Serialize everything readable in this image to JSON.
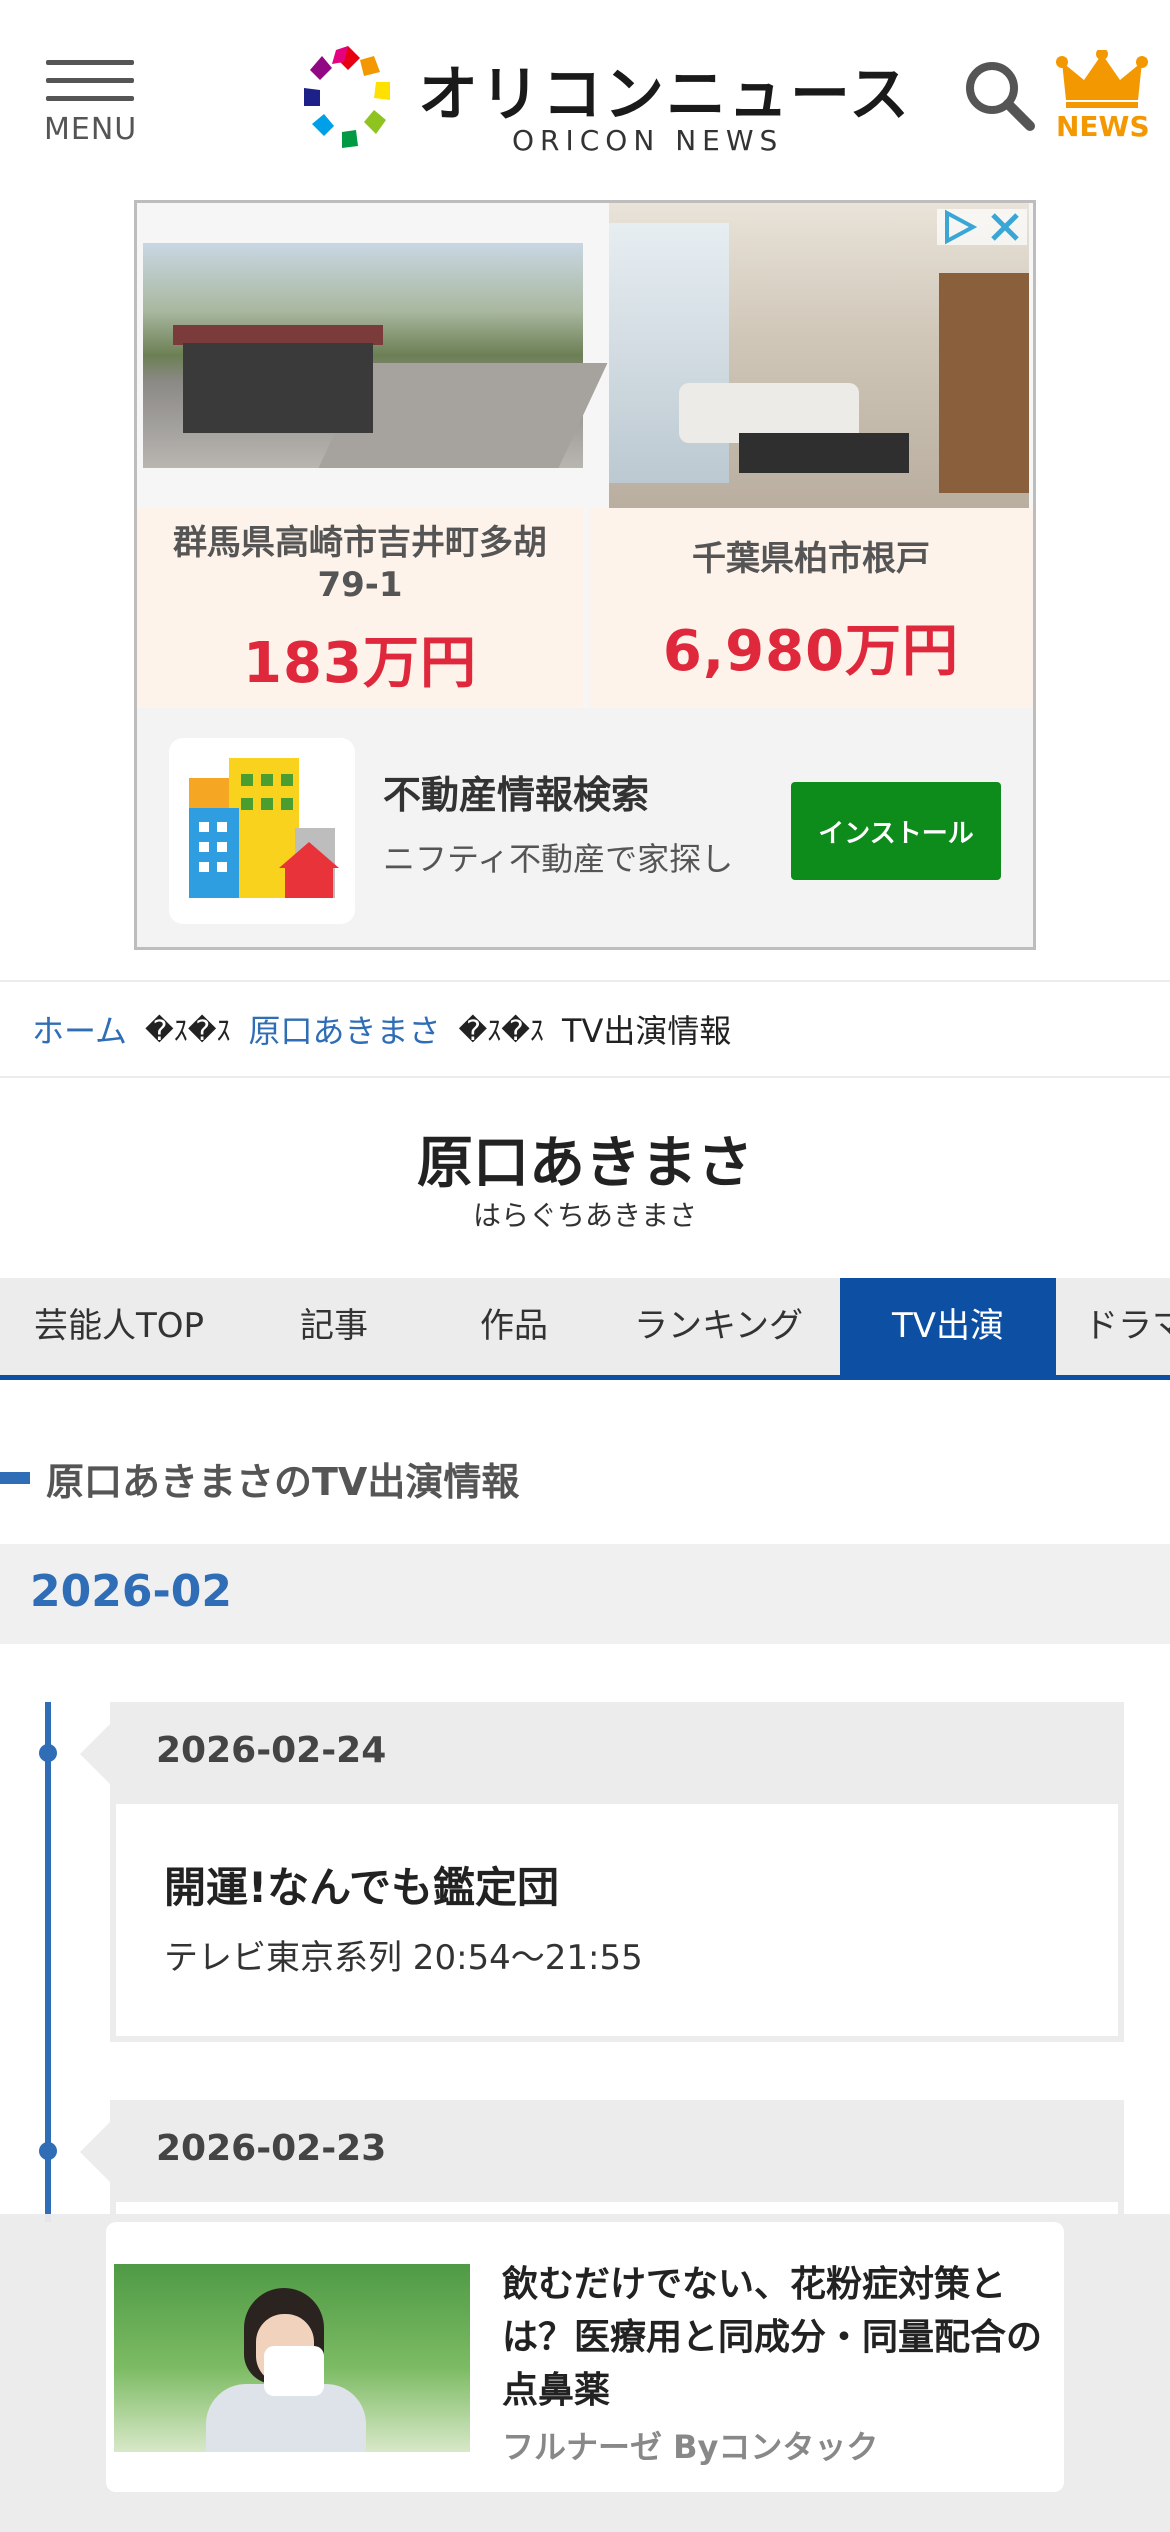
{
  "header": {
    "menu_label": "MENU",
    "logo_ja": "オリコンニュース",
    "logo_en": "ORICON NEWS",
    "news_label": "NEWS"
  },
  "ad": {
    "cards": [
      {
        "address": "群馬県高崎市吉井町多胡79-1",
        "address_line1": "群馬県高崎市吉井町多胡",
        "address_line2": "79-1",
        "price": "183万円"
      },
      {
        "address": "千葉県柏市根戸",
        "price": "6,980万円"
      }
    ],
    "app_title": "不動産情報検索",
    "app_desc": "ニフティ不動産で家探し",
    "install_label": "インストール"
  },
  "breadcrumb": {
    "home": "ホーム",
    "separator": "�ｽ�ｽ",
    "person": "原口あきまさ",
    "current": "TV出演情報"
  },
  "person": {
    "name": "原口あきまさ",
    "kana": "はらぐちあきまさ"
  },
  "tabs": [
    {
      "label": "芸能人TOP"
    },
    {
      "label": "記事"
    },
    {
      "label": "作品"
    },
    {
      "label": "ランキング"
    },
    {
      "label": "TV出演",
      "active": true
    },
    {
      "label": "ドラマ"
    }
  ],
  "section_heading": "原口あきまさのTV出演情報",
  "month": "2026-02",
  "entries": [
    {
      "date": "2026-02-24",
      "title": "開運!なんでも鑑定団",
      "info": "テレビ東京系列 20:54～21:55"
    },
    {
      "date": "2026-02-23"
    }
  ],
  "sticky_ad": {
    "title": "飲むだけでない、花粉症対策とは？医療用と同成分・同量配合の点鼻薬",
    "sponsor": "フルナーゼ Byコンタック"
  },
  "colors": {
    "brand_blue": "#0c4fa3",
    "link_blue": "#2f6db6",
    "price_red": "#e0283c",
    "install_green": "#0d8b1b",
    "news_orange": "#f39800"
  }
}
